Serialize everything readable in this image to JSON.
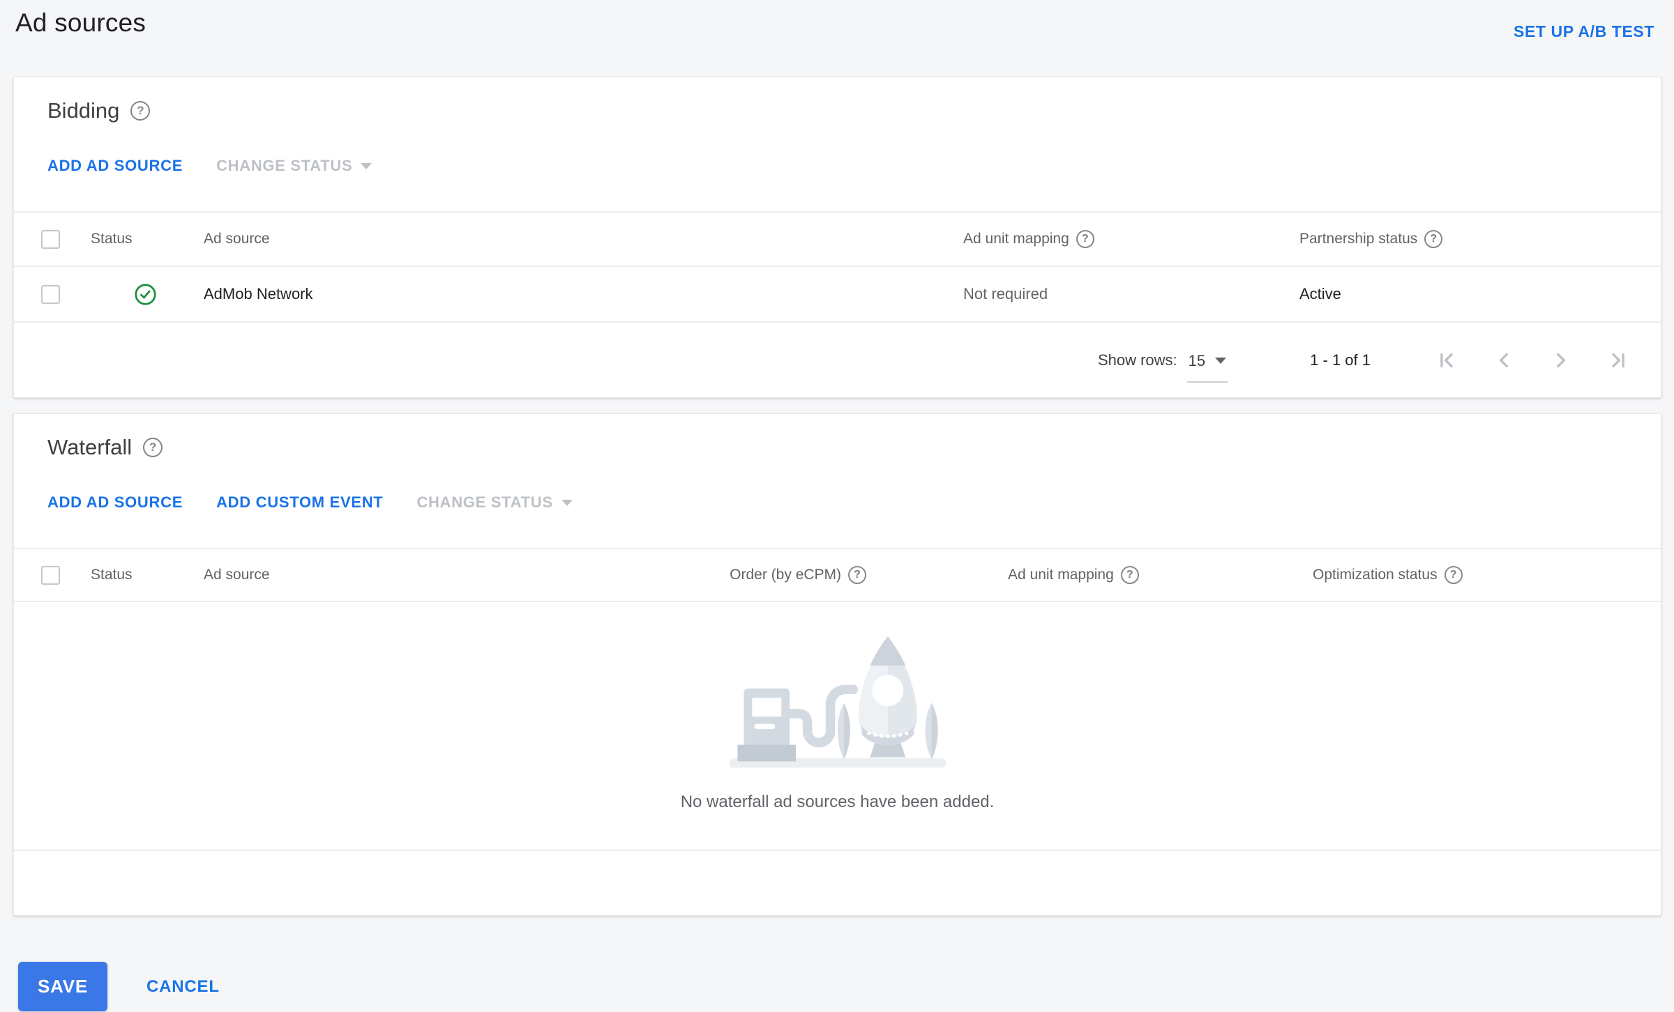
{
  "page": {
    "title": "Ad sources",
    "setup_ab_test": "SET UP A/B TEST"
  },
  "icons": {
    "help_glyph": "?"
  },
  "bidding": {
    "title": "Bidding",
    "actions": {
      "add_ad_source": "ADD AD SOURCE",
      "change_status": "CHANGE STATUS"
    },
    "columns": {
      "status": "Status",
      "ad_source": "Ad source",
      "ad_unit_mapping": "Ad unit mapping",
      "partnership_status": "Partnership status"
    },
    "rows": [
      {
        "status_icon": "check-circle",
        "ad_source": "AdMob Network",
        "ad_unit_mapping": "Not required",
        "partnership_status": "Active"
      }
    ],
    "pagination": {
      "show_rows_label": "Show rows:",
      "show_rows_value": "15",
      "range": "1 - 1 of 1"
    }
  },
  "waterfall": {
    "title": "Waterfall",
    "actions": {
      "add_ad_source": "ADD AD SOURCE",
      "add_custom_event": "ADD CUSTOM EVENT",
      "change_status": "CHANGE STATUS"
    },
    "columns": {
      "status": "Status",
      "ad_source": "Ad source",
      "order": "Order (by eCPM)",
      "ad_unit_mapping": "Ad unit mapping",
      "optimization_status": "Optimization status"
    },
    "empty_message": "No waterfall ad sources have been added."
  },
  "footer": {
    "save_label": "SAVE",
    "cancel_label": "CANCEL"
  },
  "colors": {
    "link_blue": "#1a73e8",
    "save_button_blue": "#3b78e7",
    "status_check_green": "#1e8e3e",
    "disabled_gray": "#bdc1c6",
    "header_text_gray": "#5f6368",
    "page_background": "#f5f6f8"
  }
}
